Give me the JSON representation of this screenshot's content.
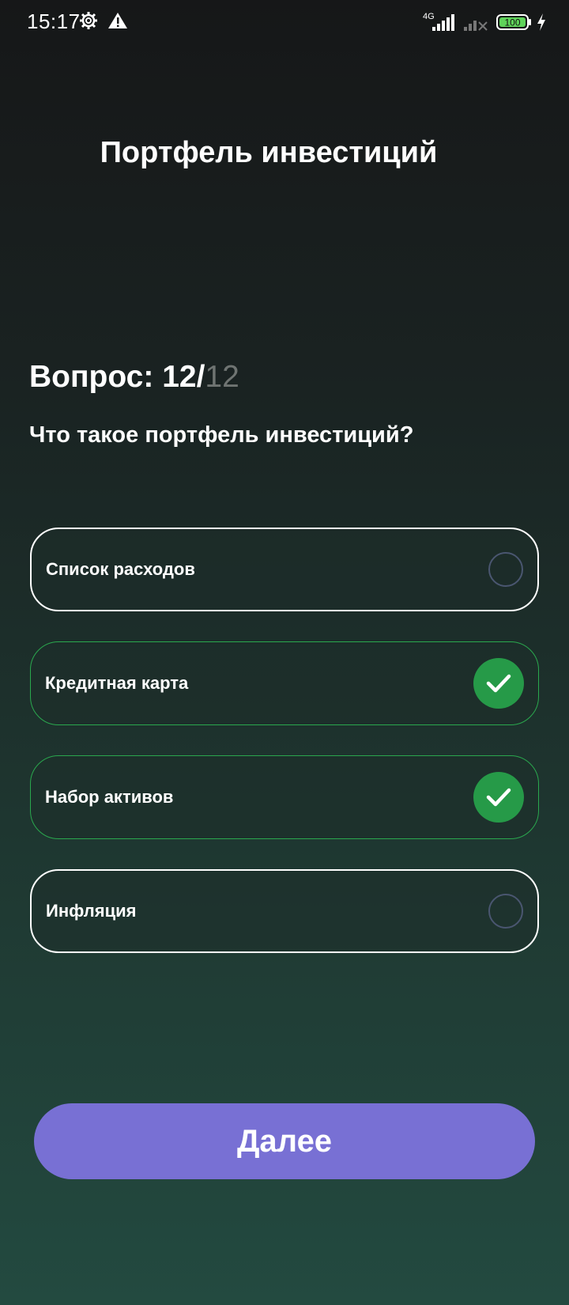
{
  "status_bar": {
    "time": "15:17",
    "network": "4G",
    "battery": "100"
  },
  "header": {
    "title": "Портфель инвестиций"
  },
  "question": {
    "counter_prefix": "Вопрос: 12/",
    "counter_total": "12",
    "text": "Что такое портфель инвестиций?"
  },
  "options": [
    {
      "label": "Список расходов",
      "selected": false
    },
    {
      "label": "Кредитная карта",
      "selected": true
    },
    {
      "label": "Набор активов",
      "selected": true
    },
    {
      "label": "Инфляция",
      "selected": false
    }
  ],
  "actions": {
    "next_label": "Далее"
  },
  "colors": {
    "accent_button": "#7870d4",
    "selected_green": "#269a48",
    "selected_border": "#2aa84e",
    "radio_border": "#4a5670"
  },
  "icons": [
    "gear-icon",
    "warning-icon",
    "signal-icon",
    "battery-icon",
    "charging-icon",
    "check-icon"
  ]
}
